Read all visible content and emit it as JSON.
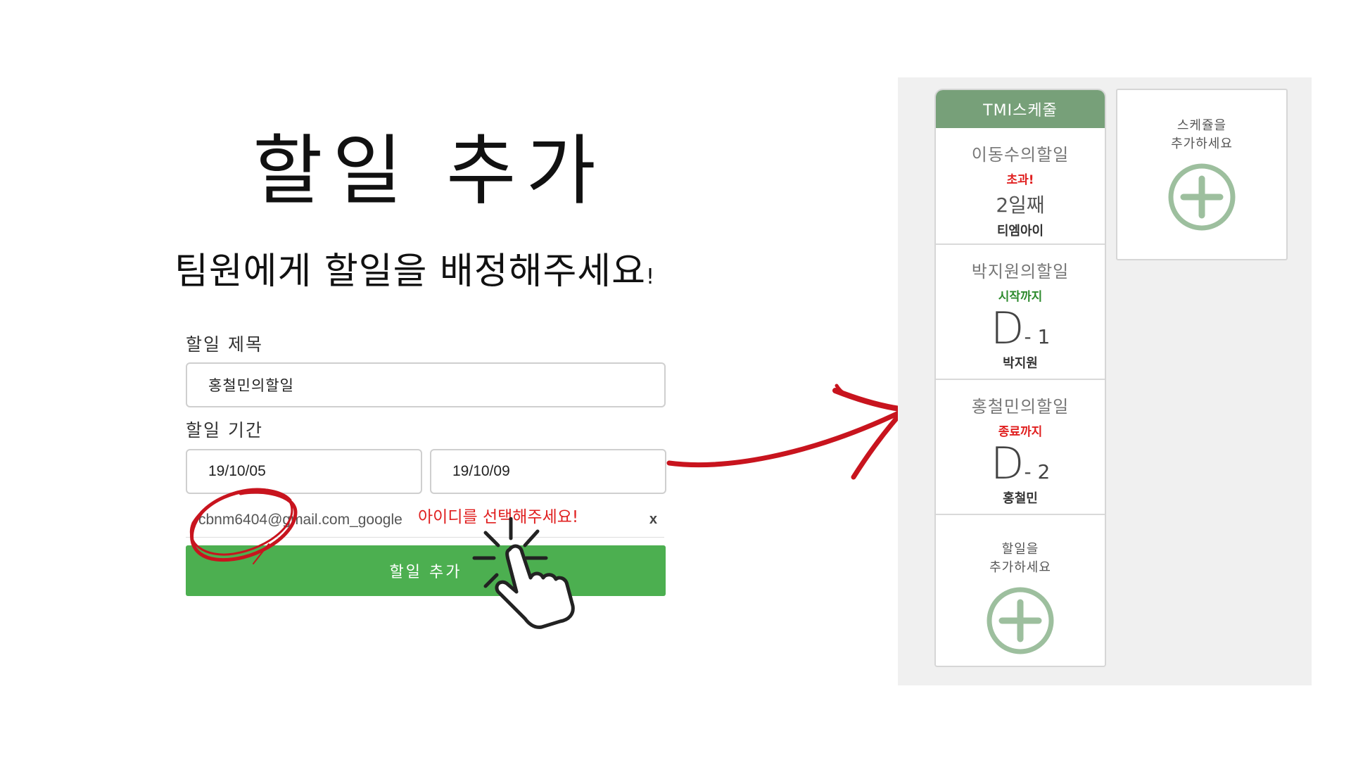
{
  "form": {
    "heading": "할일 추가",
    "subheading": "팀원에게 할일을 배정해주세요",
    "subheading_mark": "!",
    "title_label": "할일 제목",
    "title_value": "홍철민의할일",
    "period_label": "할일 기간",
    "start_date": "19/10/05",
    "end_date": "19/10/09",
    "assignee_id": "cbnm6404@gmail.com_google",
    "assignee_warning": "아이디를 선택해주세요!",
    "remove_label": "x",
    "submit_label": "할일 추가"
  },
  "panel": {
    "schedule_title": "TMI스케줄",
    "tasks": [
      {
        "title": "이동수의할일",
        "status": "초과!",
        "status_color": "#e02020",
        "count": "2일째",
        "owner": "티엠아이"
      },
      {
        "title": "박지원의할일",
        "status": "시작까지",
        "status_color": "#2e8b2e",
        "dday_letter": "D",
        "dday_num": "- 1",
        "owner": "박지원"
      },
      {
        "title": "홍철민의할일",
        "status": "종료까지",
        "status_color": "#e02020",
        "dday_letter": "D",
        "dday_num": "- 2",
        "owner": "홍철민"
      }
    ],
    "add_task_line1": "할일을",
    "add_task_line2": "추가하세요",
    "add_schedule_line1": "스케쥴을",
    "add_schedule_line2": "추가하세요"
  },
  "colors": {
    "accent_green": "#4caf50",
    "header_green": "#77a079",
    "plus_green": "#9dbf9e",
    "annotation_red": "#c8141e"
  }
}
